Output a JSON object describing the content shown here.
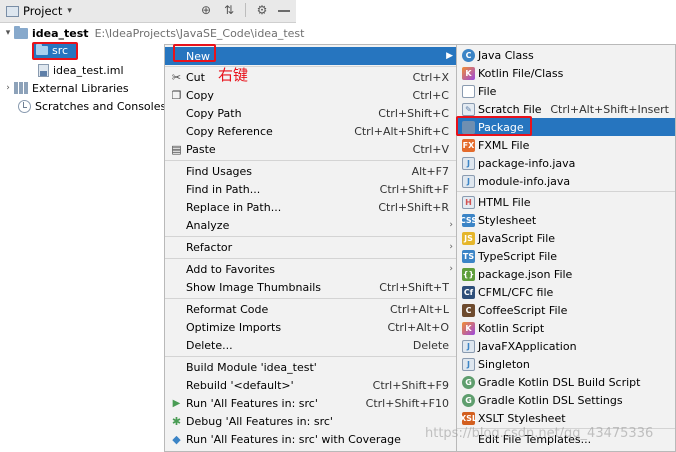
{
  "project_panel": {
    "title": "Project",
    "tree": {
      "root": {
        "name": "idea_test",
        "path": "E:\\IdeaProjects\\JavaSE_Code\\idea_test"
      },
      "src": "src",
      "iml": "idea_test.iml",
      "external_libraries": "External Libraries",
      "scratches": "Scratches and Consoles"
    }
  },
  "annotation": "右键",
  "context_menu": {
    "new": "New",
    "items": [
      {
        "label": "Cut",
        "shortcut": "Ctrl+X"
      },
      {
        "label": "Copy",
        "shortcut": "Ctrl+C"
      },
      {
        "label": "Copy Path",
        "shortcut": "Ctrl+Shift+C"
      },
      {
        "label": "Copy Reference",
        "shortcut": "Ctrl+Alt+Shift+C"
      },
      {
        "label": "Paste",
        "shortcut": "Ctrl+V"
      },
      {
        "label": "Find Usages",
        "shortcut": "Alt+F7"
      },
      {
        "label": "Find in Path...",
        "shortcut": "Ctrl+Shift+F"
      },
      {
        "label": "Replace in Path...",
        "shortcut": "Ctrl+Shift+R"
      },
      {
        "label": "Analyze",
        "shortcut": ""
      },
      {
        "label": "Refactor",
        "shortcut": ""
      },
      {
        "label": "Add to Favorites",
        "shortcut": ""
      },
      {
        "label": "Show Image Thumbnails",
        "shortcut": "Ctrl+Shift+T"
      },
      {
        "label": "Reformat Code",
        "shortcut": "Ctrl+Alt+L"
      },
      {
        "label": "Optimize Imports",
        "shortcut": "Ctrl+Alt+O"
      },
      {
        "label": "Delete...",
        "shortcut": "Delete"
      },
      {
        "label": "Build Module 'idea_test'",
        "shortcut": ""
      },
      {
        "label": "Rebuild '<default>'",
        "shortcut": "Ctrl+Shift+F9"
      },
      {
        "label": "Run 'All Features in: src'",
        "shortcut": "Ctrl+Shift+F10"
      },
      {
        "label": "Debug 'All Features in: src'",
        "shortcut": ""
      },
      {
        "label": "Run 'All Features in: src' with Coverage",
        "shortcut": ""
      }
    ]
  },
  "submenu": {
    "items": [
      {
        "label": "Java Class",
        "shortcut": ""
      },
      {
        "label": "Kotlin File/Class",
        "shortcut": ""
      },
      {
        "label": "File",
        "shortcut": ""
      },
      {
        "label": "Scratch File",
        "shortcut": "Ctrl+Alt+Shift+Insert"
      },
      {
        "label": "Package",
        "shortcut": ""
      },
      {
        "label": "FXML File",
        "shortcut": ""
      },
      {
        "label": "package-info.java",
        "shortcut": ""
      },
      {
        "label": "module-info.java",
        "shortcut": ""
      },
      {
        "label": "HTML File",
        "shortcut": ""
      },
      {
        "label": "Stylesheet",
        "shortcut": ""
      },
      {
        "label": "JavaScript File",
        "shortcut": ""
      },
      {
        "label": "TypeScript File",
        "shortcut": ""
      },
      {
        "label": "package.json File",
        "shortcut": ""
      },
      {
        "label": "CFML/CFC file",
        "shortcut": ""
      },
      {
        "label": "CoffeeScript File",
        "shortcut": ""
      },
      {
        "label": "Kotlin Script",
        "shortcut": ""
      },
      {
        "label": "JavaFXApplication",
        "shortcut": ""
      },
      {
        "label": "Singleton",
        "shortcut": ""
      },
      {
        "label": "Gradle Kotlin DSL Build Script",
        "shortcut": ""
      },
      {
        "label": "Gradle Kotlin DSL Settings",
        "shortcut": ""
      },
      {
        "label": "XSLT Stylesheet",
        "shortcut": ""
      },
      {
        "label": "Edit File Templates...",
        "shortcut": ""
      }
    ]
  },
  "watermark": "https://blog.csdn.net/qq_43475336",
  "colors": {
    "selection": "#2675bf",
    "highlight_box": "#e8121b",
    "menu_bg": "#f2f2f2"
  }
}
